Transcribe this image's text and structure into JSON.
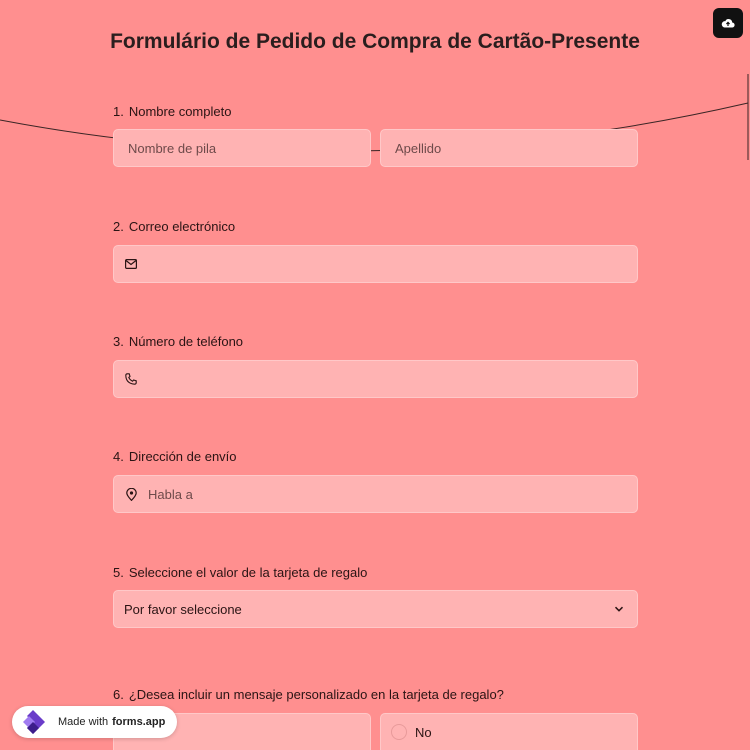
{
  "form": {
    "title": "Formulário de Pedido de Compra de Cartão-Presente"
  },
  "questions": {
    "q1": {
      "number": "1.",
      "label": "Nombre completo",
      "first_placeholder": "Nombre de pila",
      "last_placeholder": "Apellido"
    },
    "q2": {
      "number": "2.",
      "label": "Correo electrónico"
    },
    "q3": {
      "number": "3.",
      "label": "Número de teléfono"
    },
    "q4": {
      "number": "4.",
      "label": "Dirección de envío",
      "placeholder": "Habla a"
    },
    "q5": {
      "number": "5.",
      "label": "Seleccione el valor de la tarjeta de regalo",
      "selected": "Por favor seleccione"
    },
    "q6": {
      "number": "6.",
      "label": "¿Desea incluir un mensaje personalizado en la tarjeta de regalo?",
      "option_no": "No"
    }
  },
  "badge": {
    "prefix": "Made with",
    "brand": "forms.app"
  },
  "icons": {
    "upload": "cloud-upload-icon",
    "email": "mail-icon",
    "phone": "phone-icon",
    "address": "map-pin-icon",
    "select": "chevron-down-icon",
    "logo": "forms-app-logo"
  },
  "colors": {
    "background": "#ff8f8f",
    "field": "#ffb3b3",
    "text": "#2a1414"
  }
}
